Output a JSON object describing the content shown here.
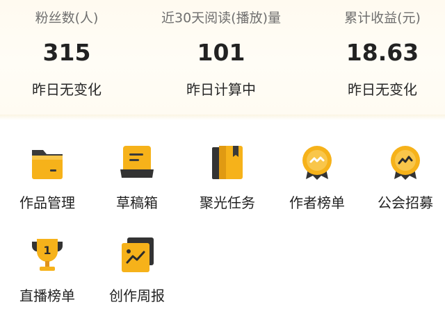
{
  "stats": [
    {
      "label": "粉丝数(人)",
      "value": "315",
      "sub": "昨日无变化"
    },
    {
      "label": "近30天阅读(播放)量",
      "value": "101",
      "sub": "昨日计算中"
    },
    {
      "label": "累计收益(元)",
      "value": "18.63",
      "sub": "昨日无变化"
    }
  ],
  "tools": [
    {
      "label": "作品管理",
      "icon": "folder-icon"
    },
    {
      "label": "草稿箱",
      "icon": "draft-box-icon"
    },
    {
      "label": "聚光任务",
      "icon": "book-icon"
    },
    {
      "label": "作者榜单",
      "icon": "author-medal-icon"
    },
    {
      "label": "公会招募",
      "icon": "guild-medal-icon"
    },
    {
      "label": "直播榜单",
      "icon": "trophy-icon"
    },
    {
      "label": "创作周报",
      "icon": "weekly-report-icon"
    }
  ],
  "colors": {
    "accent": "#f6b21a",
    "accent_dark": "#e0931a",
    "icon_dark": "#2b2b2b"
  }
}
